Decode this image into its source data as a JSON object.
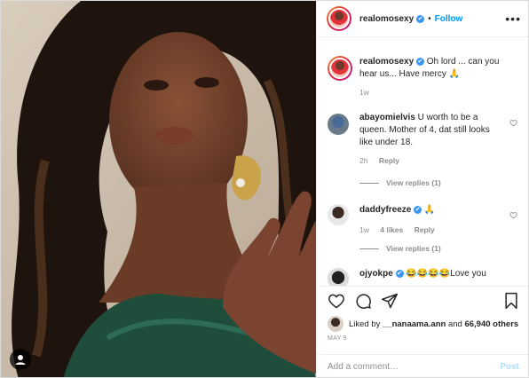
{
  "header": {
    "username": "realomosexy",
    "verified_mark": "✔",
    "separator": "•",
    "follow_label": "Follow",
    "more_label": "•••"
  },
  "caption": {
    "username": "realomosexy",
    "text": "Oh lord ... can you hear us... Have mercy 🙏",
    "time": "1w"
  },
  "comments": [
    {
      "username": "abayomielvis",
      "text": "U worth to be a queen. Mother of 4, dat still looks like under 18.",
      "time": "2h",
      "reply_label": "Reply",
      "view_replies": "View replies (1)"
    },
    {
      "username": "daddyfreeze",
      "verified": true,
      "text": "🙏",
      "time": "1w",
      "likes": "4 likes",
      "reply_label": "Reply",
      "view_replies": "View replies (1)"
    },
    {
      "username": "ojyokpe",
      "verified": true,
      "text": "😂😂😂😂Love you"
    }
  ],
  "actions": {
    "liked_by_prefix": "Liked by",
    "liked_by_user": "__nanaama.ann",
    "liked_by_and": "and",
    "liked_by_others": "66,940 others",
    "date": "MAY 9"
  },
  "add_comment": {
    "placeholder": "Add a comment…",
    "post_label": "Post"
  },
  "colors": {
    "accent": "#0095f6",
    "verified": "#3897f0",
    "muted": "#8e8e8e"
  },
  "icons": [
    "heart-icon",
    "comment-icon",
    "share-icon",
    "bookmark-icon",
    "tag-user-icon",
    "more-icon"
  ]
}
